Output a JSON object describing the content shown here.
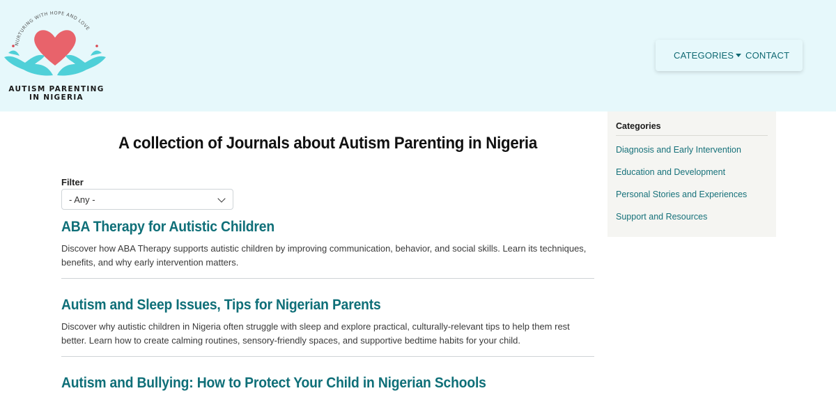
{
  "logo": {
    "tagline": "NURTURING WITH HOPE AND LOVE",
    "name_line1": "AUTISM PARENTING",
    "name_line2": "IN NIGERIA",
    "colors": {
      "heart": "#e8636b",
      "hands": "#4fd0d8",
      "dots": "#d9444e"
    }
  },
  "nav": {
    "categories_label": "CATEGORIES",
    "contact_label": "CONTACT"
  },
  "main": {
    "title": "A collection of Journals about Autism Parenting in Nigeria",
    "filter": {
      "label": "Filter",
      "selected": "- Any -"
    },
    "articles": [
      {
        "title": "ABA Therapy for Autistic Children",
        "description": "Discover how ABA Therapy supports autistic children by improving communication, behavior, and social skills. Learn its techniques, benefits, and why early intervention matters."
      },
      {
        "title": "Autism and Sleep Issues, Tips for Nigerian Parents",
        "description": "Discover why autistic children in Nigeria often struggle with sleep and explore practical, culturally-relevant tips to help them rest better. Learn how to create calming routines, sensory-friendly spaces, and supportive bedtime habits for your child."
      },
      {
        "title": "Autism and Bullying: How to Protect Your Child in Nigerian Schools",
        "description": ""
      }
    ]
  },
  "sidebar": {
    "heading": "Categories",
    "items": [
      {
        "label": "Diagnosis and Early Intervention"
      },
      {
        "label": "Education and Development"
      },
      {
        "label": "Personal Stories and Experiences"
      },
      {
        "label": "Support and Resources"
      }
    ]
  },
  "colors": {
    "header_bg": "#e6f8fb",
    "link": "#0f6f78",
    "sidebar_bg": "#f5f5f2"
  }
}
